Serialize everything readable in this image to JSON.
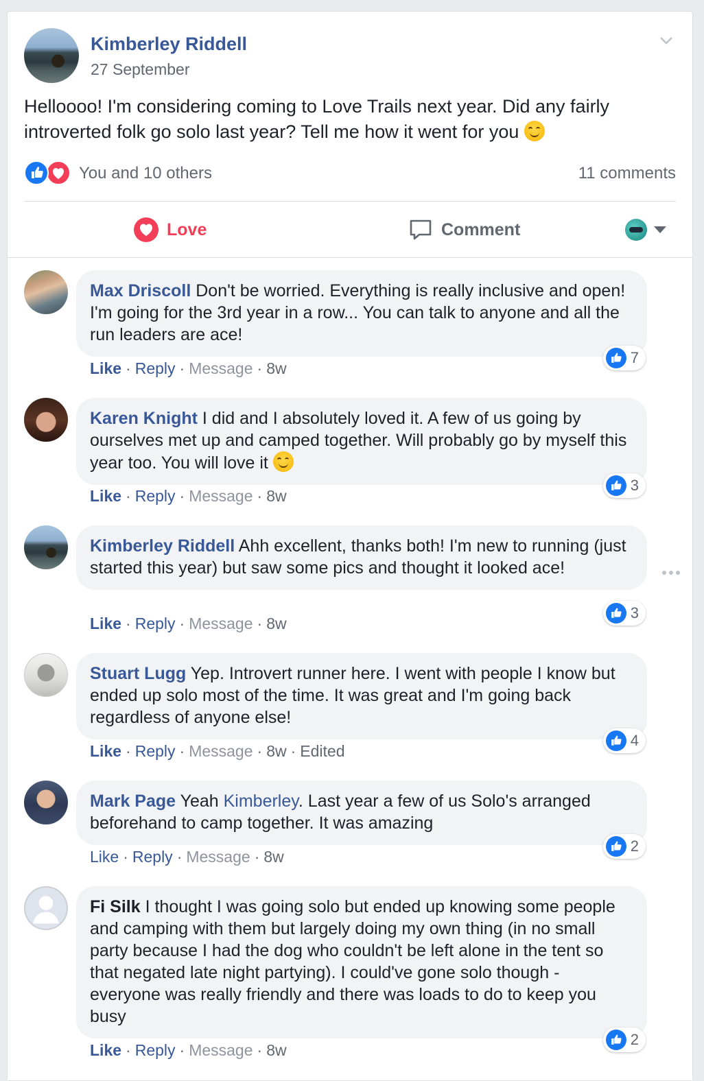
{
  "post": {
    "author": "Kimberley Riddell",
    "date": "27 September",
    "text": "Helloooo! I'm considering coming to Love Trails next year. Did any fairly introverted folk go solo last year? Tell me how it went for you",
    "reactions_text": "You and 10 others",
    "comments_count": "11 comments",
    "actions": {
      "love_label": "Love",
      "comment_label": "Comment"
    }
  },
  "comment_actions": {
    "like": "Like",
    "reply": "Reply",
    "message": "Message",
    "separator": "·"
  },
  "comments": [
    {
      "name": "Max Driscoll",
      "text": "Don't be worried. Everything is really inclusive and open! I'm going for the 3rd year in a row... You can talk to anyone and all the run leaders are ace!",
      "likes": "7",
      "age": "8w"
    },
    {
      "name": "Karen Knight",
      "text": "I did and I absolutely loved it. A few of us going by ourselves met up and camped together. Will probably go by myself this year too. You will love it",
      "likes": "3",
      "age": "8w"
    },
    {
      "name": "Kimberley Riddell",
      "text": "Ahh excellent, thanks both! I'm new to running (just started this year) but saw some pics and thought it looked ace!",
      "likes": "3",
      "age": "8w"
    },
    {
      "name": "Stuart Lugg",
      "text": "Yep. Introvert runner here. I went with people I know but ended up solo most of the time. It was great and I'm going back regardless of anyone else!",
      "likes": "4",
      "age": "8w",
      "edited": "Edited"
    },
    {
      "name": "Mark Page",
      "pre_text": "Yeah",
      "mention": "Kimberley",
      "text": ". Last year a few of us Solo's arranged beforehand to camp together. It was amazing",
      "likes": "2",
      "age": "8w"
    },
    {
      "name": "Fi Silk",
      "text": "I thought I was going solo but ended up knowing some people and camping with them but largely doing my own thing (in no small party because I had the dog who couldn't be left alone in the tent so that negated late night partying). I could've gone solo though - everyone was really friendly and there was loads to do to keep you busy",
      "likes": "2",
      "age": "8w"
    }
  ],
  "colors": {
    "link": "#385898",
    "love": "#f33e58",
    "like_blue": "#1877f2",
    "bubble": "#f2f3f5",
    "meta": "#606770"
  }
}
